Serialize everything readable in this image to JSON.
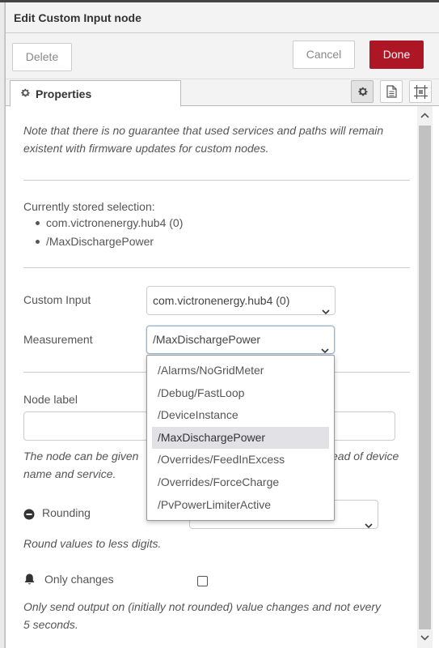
{
  "tray": {
    "title": "Edit Custom Input node"
  },
  "toolbar": {
    "delete_label": "Delete",
    "cancel_label": "Cancel",
    "done_label": "Done"
  },
  "tabs": {
    "properties_label": "Properties"
  },
  "note_top": {
    "line1": "Note that there is no guarantee that used services and paths will remain",
    "line2": "existent with firmware updates for custom nodes."
  },
  "stored": {
    "heading": "Currently stored selection:",
    "items": [
      "com.victronenergy.hub4 (0)",
      "/MaxDischargePower"
    ]
  },
  "custom_input": {
    "label": "Custom Input",
    "value": "com.victronenergy.hub4 (0)"
  },
  "measurement": {
    "label": "Measurement",
    "value": "/MaxDischargePower",
    "options": [
      "/Alarms/NoGridMeter",
      "/Debug/FastLoop",
      "/DeviceInstance",
      "/MaxDischargePower",
      "/Overrides/FeedInExcess",
      "/Overrides/ForceCharge",
      "/PvPowerLimiterActive"
    ],
    "selected_index": 3
  },
  "node_label": {
    "label": "Node label",
    "value": "",
    "help_line1_start": "The node can be given",
    "help_line1_end": "ead of device",
    "help_line2": "name and service."
  },
  "rounding": {
    "label": "Rounding",
    "value": "",
    "help": "Round values to less digits."
  },
  "only_changes": {
    "label": "Only changes",
    "checked": false,
    "help_line1": "Only send output on (initially not rounded) value changes and not every",
    "help_line2": "5 seconds."
  },
  "icons": {
    "properties_tab": "gear-icon",
    "tab_settings": "gear-icon",
    "tab_description": "document-icon",
    "tab_appearance": "frame-icon",
    "rounding": "minus-circle-icon",
    "only_changes": "bell-icon"
  },
  "colors": {
    "done_button": "#ad1625",
    "selected_option": "#e2e2e6"
  }
}
